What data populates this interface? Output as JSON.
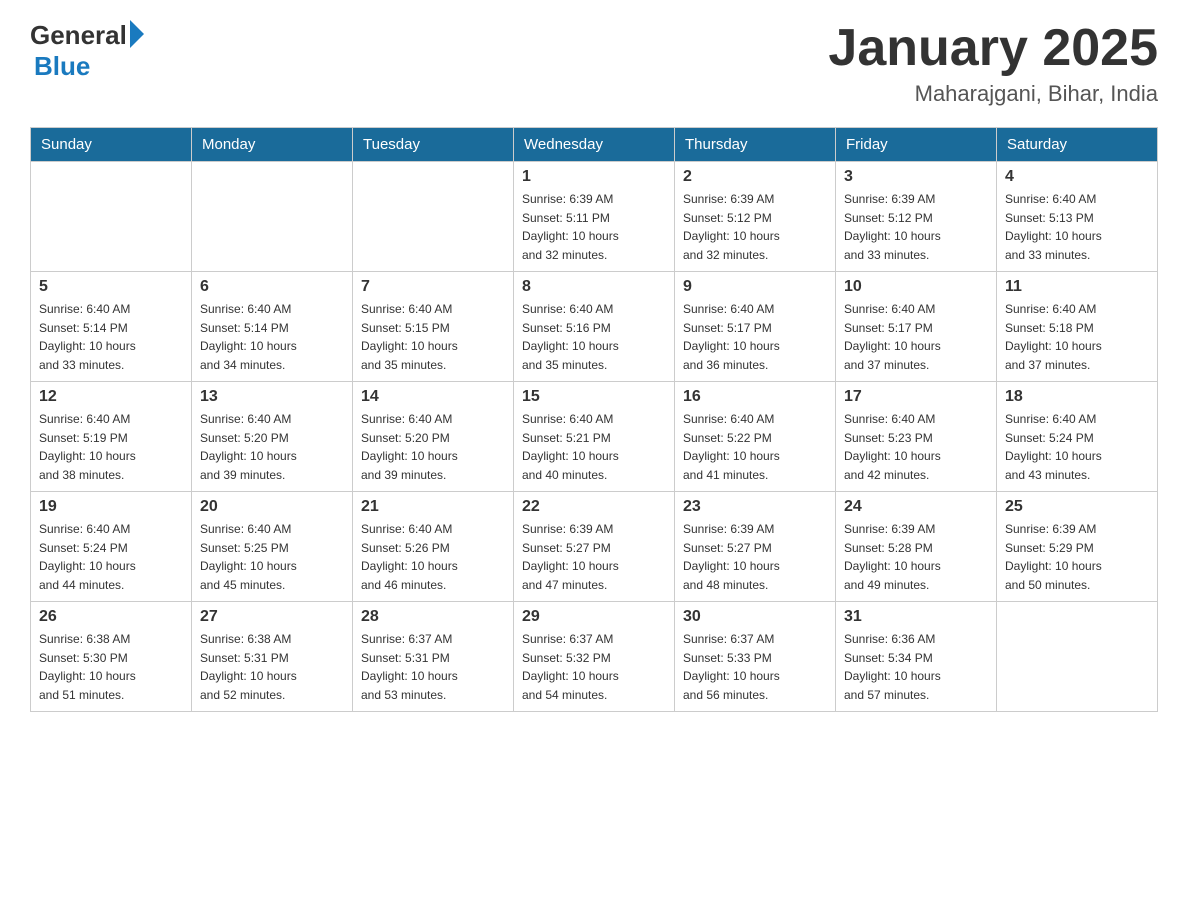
{
  "header": {
    "logo_general": "General",
    "logo_blue": "Blue",
    "month_year": "January 2025",
    "location": "Maharajgani, Bihar, India"
  },
  "weekdays": [
    "Sunday",
    "Monday",
    "Tuesday",
    "Wednesday",
    "Thursday",
    "Friday",
    "Saturday"
  ],
  "weeks": [
    [
      {
        "day": "",
        "info": ""
      },
      {
        "day": "",
        "info": ""
      },
      {
        "day": "",
        "info": ""
      },
      {
        "day": "1",
        "info": "Sunrise: 6:39 AM\nSunset: 5:11 PM\nDaylight: 10 hours\nand 32 minutes."
      },
      {
        "day": "2",
        "info": "Sunrise: 6:39 AM\nSunset: 5:12 PM\nDaylight: 10 hours\nand 32 minutes."
      },
      {
        "day": "3",
        "info": "Sunrise: 6:39 AM\nSunset: 5:12 PM\nDaylight: 10 hours\nand 33 minutes."
      },
      {
        "day": "4",
        "info": "Sunrise: 6:40 AM\nSunset: 5:13 PM\nDaylight: 10 hours\nand 33 minutes."
      }
    ],
    [
      {
        "day": "5",
        "info": "Sunrise: 6:40 AM\nSunset: 5:14 PM\nDaylight: 10 hours\nand 33 minutes."
      },
      {
        "day": "6",
        "info": "Sunrise: 6:40 AM\nSunset: 5:14 PM\nDaylight: 10 hours\nand 34 minutes."
      },
      {
        "day": "7",
        "info": "Sunrise: 6:40 AM\nSunset: 5:15 PM\nDaylight: 10 hours\nand 35 minutes."
      },
      {
        "day": "8",
        "info": "Sunrise: 6:40 AM\nSunset: 5:16 PM\nDaylight: 10 hours\nand 35 minutes."
      },
      {
        "day": "9",
        "info": "Sunrise: 6:40 AM\nSunset: 5:17 PM\nDaylight: 10 hours\nand 36 minutes."
      },
      {
        "day": "10",
        "info": "Sunrise: 6:40 AM\nSunset: 5:17 PM\nDaylight: 10 hours\nand 37 minutes."
      },
      {
        "day": "11",
        "info": "Sunrise: 6:40 AM\nSunset: 5:18 PM\nDaylight: 10 hours\nand 37 minutes."
      }
    ],
    [
      {
        "day": "12",
        "info": "Sunrise: 6:40 AM\nSunset: 5:19 PM\nDaylight: 10 hours\nand 38 minutes."
      },
      {
        "day": "13",
        "info": "Sunrise: 6:40 AM\nSunset: 5:20 PM\nDaylight: 10 hours\nand 39 minutes."
      },
      {
        "day": "14",
        "info": "Sunrise: 6:40 AM\nSunset: 5:20 PM\nDaylight: 10 hours\nand 39 minutes."
      },
      {
        "day": "15",
        "info": "Sunrise: 6:40 AM\nSunset: 5:21 PM\nDaylight: 10 hours\nand 40 minutes."
      },
      {
        "day": "16",
        "info": "Sunrise: 6:40 AM\nSunset: 5:22 PM\nDaylight: 10 hours\nand 41 minutes."
      },
      {
        "day": "17",
        "info": "Sunrise: 6:40 AM\nSunset: 5:23 PM\nDaylight: 10 hours\nand 42 minutes."
      },
      {
        "day": "18",
        "info": "Sunrise: 6:40 AM\nSunset: 5:24 PM\nDaylight: 10 hours\nand 43 minutes."
      }
    ],
    [
      {
        "day": "19",
        "info": "Sunrise: 6:40 AM\nSunset: 5:24 PM\nDaylight: 10 hours\nand 44 minutes."
      },
      {
        "day": "20",
        "info": "Sunrise: 6:40 AM\nSunset: 5:25 PM\nDaylight: 10 hours\nand 45 minutes."
      },
      {
        "day": "21",
        "info": "Sunrise: 6:40 AM\nSunset: 5:26 PM\nDaylight: 10 hours\nand 46 minutes."
      },
      {
        "day": "22",
        "info": "Sunrise: 6:39 AM\nSunset: 5:27 PM\nDaylight: 10 hours\nand 47 minutes."
      },
      {
        "day": "23",
        "info": "Sunrise: 6:39 AM\nSunset: 5:27 PM\nDaylight: 10 hours\nand 48 minutes."
      },
      {
        "day": "24",
        "info": "Sunrise: 6:39 AM\nSunset: 5:28 PM\nDaylight: 10 hours\nand 49 minutes."
      },
      {
        "day": "25",
        "info": "Sunrise: 6:39 AM\nSunset: 5:29 PM\nDaylight: 10 hours\nand 50 minutes."
      }
    ],
    [
      {
        "day": "26",
        "info": "Sunrise: 6:38 AM\nSunset: 5:30 PM\nDaylight: 10 hours\nand 51 minutes."
      },
      {
        "day": "27",
        "info": "Sunrise: 6:38 AM\nSunset: 5:31 PM\nDaylight: 10 hours\nand 52 minutes."
      },
      {
        "day": "28",
        "info": "Sunrise: 6:37 AM\nSunset: 5:31 PM\nDaylight: 10 hours\nand 53 minutes."
      },
      {
        "day": "29",
        "info": "Sunrise: 6:37 AM\nSunset: 5:32 PM\nDaylight: 10 hours\nand 54 minutes."
      },
      {
        "day": "30",
        "info": "Sunrise: 6:37 AM\nSunset: 5:33 PM\nDaylight: 10 hours\nand 56 minutes."
      },
      {
        "day": "31",
        "info": "Sunrise: 6:36 AM\nSunset: 5:34 PM\nDaylight: 10 hours\nand 57 minutes."
      },
      {
        "day": "",
        "info": ""
      }
    ]
  ]
}
